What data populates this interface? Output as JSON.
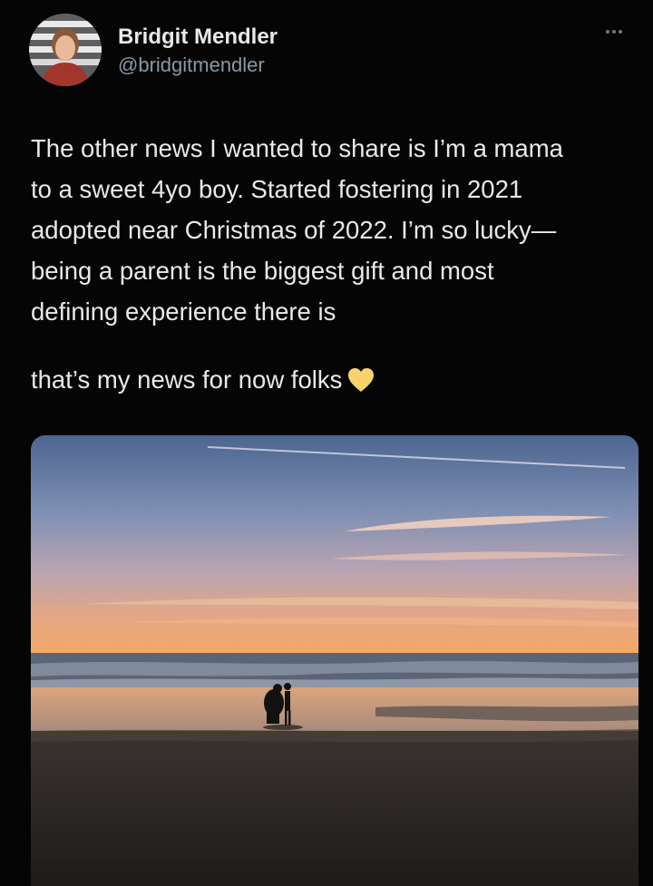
{
  "author": {
    "name": "Bridgit Mendler",
    "handle": "@bridgitmendler"
  },
  "menu": {
    "more_icon": "more-horizontal-icon"
  },
  "tweet": {
    "lines": [
      "The other news I wanted to share is I’m a mama",
      "to a sweet 4yo boy. Started fostering in 2021",
      "adopted near Christmas of 2022. I’m so lucky—",
      "being a parent is the biggest gift and most",
      "defining experience there is"
    ],
    "closing": "that’s my news for now folks",
    "closing_emoji": "yellow-heart-icon"
  },
  "media": {
    "icon": "photo-beach-sunset"
  },
  "colors": {
    "background": "#050505",
    "text": "#e7e9ea",
    "secondary": "#8b98a5",
    "heart": "#f7d46b"
  }
}
